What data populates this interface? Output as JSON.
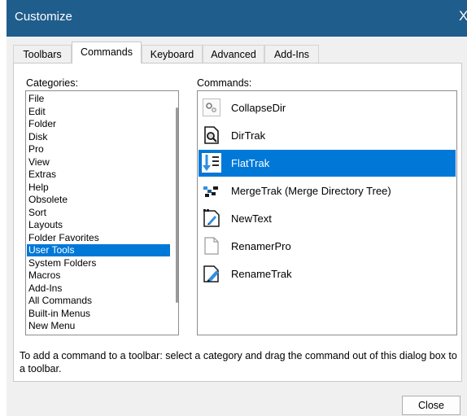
{
  "window": {
    "title": "Customize",
    "close_glyph": "X"
  },
  "tabs": [
    {
      "label": "Toolbars"
    },
    {
      "label": "Commands"
    },
    {
      "label": "Keyboard"
    },
    {
      "label": "Advanced"
    },
    {
      "label": "Add-Ins"
    }
  ],
  "active_tab": "Commands",
  "categories": {
    "label": "Categories:",
    "items": [
      "File",
      "Edit",
      "Folder",
      "Disk",
      "Pro",
      "View",
      "Extras",
      "Help",
      "Obsolete",
      "Sort",
      "Layouts",
      "Folder Favorites",
      "User Tools",
      "System Folders",
      "Macros",
      "Add-Ins",
      "All Commands",
      "Built-in Menus",
      "New Menu"
    ],
    "selected": "User Tools"
  },
  "commands": {
    "label": "Commands:",
    "items": [
      {
        "label": "CollapseDir",
        "icon": "collapse-dir-icon"
      },
      {
        "label": "DirTrak",
        "icon": "dirtrak-icon"
      },
      {
        "label": "FlatTrak",
        "icon": "flattrak-icon"
      },
      {
        "label": "MergeTrak (Merge Directory Tree)",
        "icon": "mergetrak-icon"
      },
      {
        "label": "NewText",
        "icon": "newtext-icon"
      },
      {
        "label": "RenamerPro",
        "icon": "renamerpro-icon"
      },
      {
        "label": "RenameTrak",
        "icon": "renametrak-icon"
      }
    ],
    "selected": "FlatTrak"
  },
  "help_text": "To add a command to a toolbar: select a category and drag the command out of this dialog box to a toolbar.",
  "buttons": {
    "close": "Close"
  },
  "colors": {
    "titlebar": "#1f5d8c",
    "selection": "#0078d7",
    "dialog_bg": "#f0f0f0"
  }
}
